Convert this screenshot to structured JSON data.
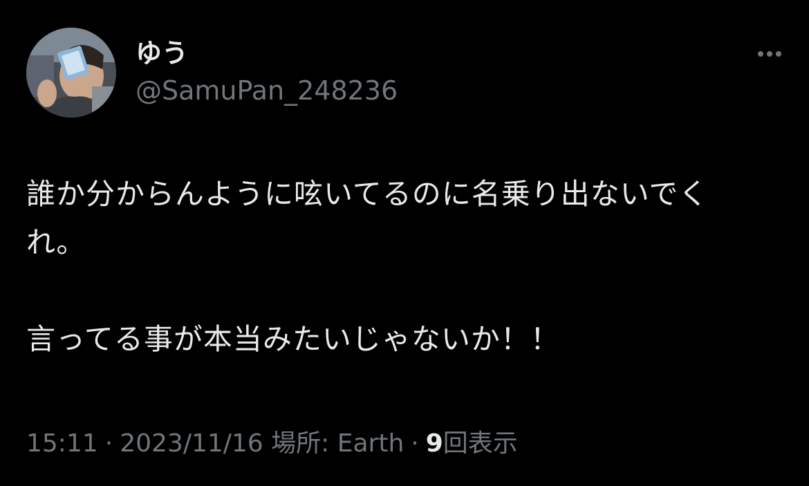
{
  "user": {
    "display_name": "ゆう",
    "handle": "@SamuPan_248236",
    "avatar_icon": "user-avatar-photo"
  },
  "more_icon": "more-horizontal-icon",
  "tweet": {
    "lines": [
      "誰か分からんように呟いてるのに名乗り出ないでく",
      "れ。",
      "",
      "言ってる事が本当みたいじゃないか！！"
    ]
  },
  "meta": {
    "time": "15:11",
    "separator": "·",
    "date": "2023/11/16",
    "location": "場所: Earth",
    "views_count": "9",
    "views_label": "回表示"
  },
  "colors": {
    "background": "#000000",
    "primary_text": "#e7e9ea",
    "secondary_text": "#71767b"
  }
}
